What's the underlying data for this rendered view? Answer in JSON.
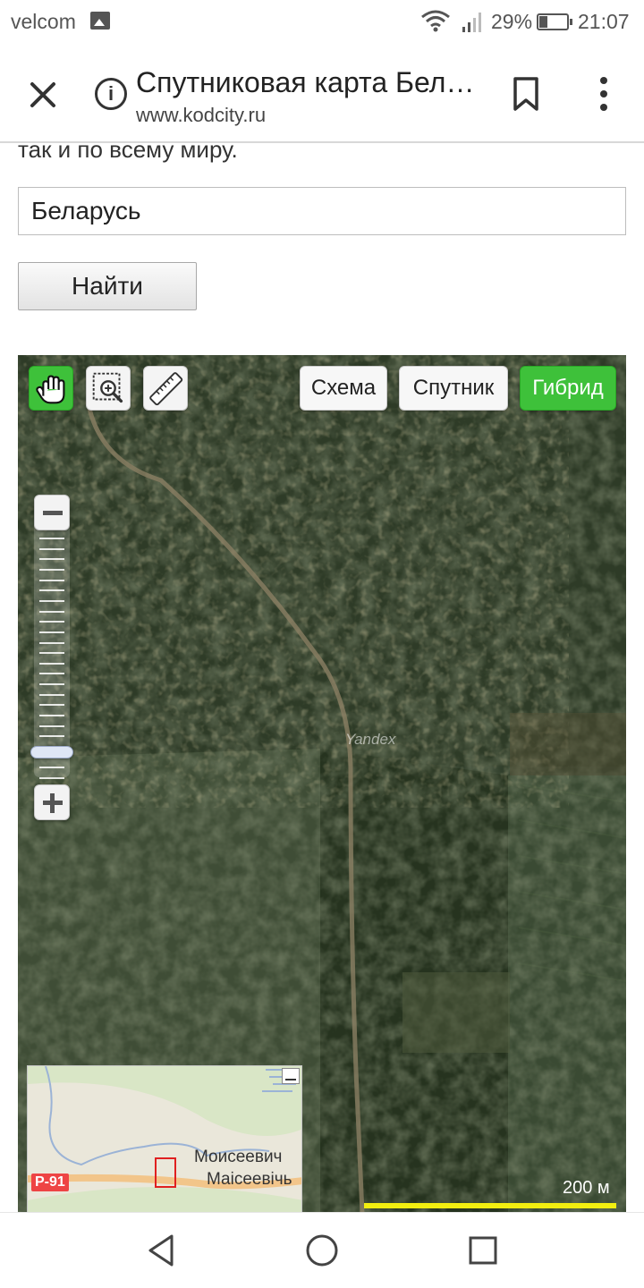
{
  "status_bar": {
    "carrier": "velcom",
    "battery_percent": "29%",
    "time": "21:07",
    "icons": [
      "gallery-icon",
      "wifi-icon",
      "signal-icon",
      "battery-icon"
    ]
  },
  "browser": {
    "page_title": "Спутниковая карта Бел…",
    "url": "www.kodcity.ru",
    "icons": [
      "close-icon",
      "info-icon",
      "bookmark-icon",
      "more-vert-icon"
    ]
  },
  "page": {
    "intro_text": "так и по всему миру.",
    "search": {
      "value": "Беларусь",
      "placeholder": ""
    },
    "find_button": "Найти"
  },
  "map": {
    "tools": [
      "hand-pan-icon",
      "zoom-select-icon",
      "ruler-icon"
    ],
    "active_tool": "hand-pan-icon",
    "layers": [
      "Схема",
      "Спутник",
      "Гибрид"
    ],
    "active_layer": "Гибрид",
    "zoom_level_fraction": 0.87,
    "watermark": "Yandex",
    "overview": {
      "road": "Р-91",
      "place_ru": "Моисеевич",
      "place_be": "Маісеевічь"
    },
    "scale_label": "200 м",
    "colors": {
      "active": "#3ec13a",
      "scale_bar": "#f2ee10",
      "overview_viewport": "#e02020"
    }
  },
  "nav_bar": {
    "icons": [
      "back-icon",
      "home-icon",
      "recents-icon"
    ]
  }
}
